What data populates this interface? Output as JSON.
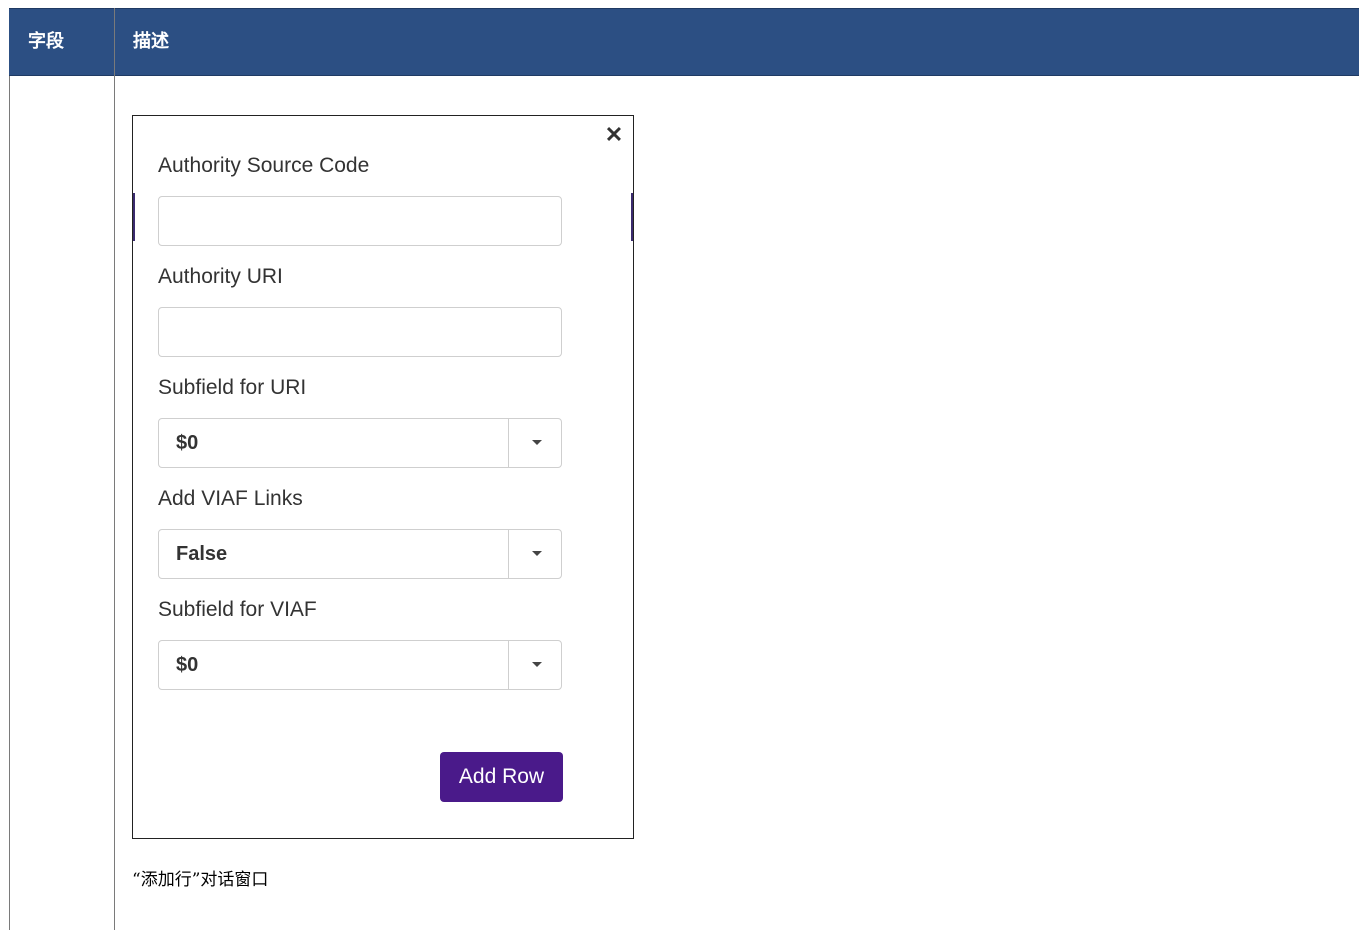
{
  "table": {
    "headers": [
      "字段",
      "描述"
    ]
  },
  "dialog": {
    "fields": [
      {
        "label": "Authority Source Code",
        "value": ""
      },
      {
        "label": "Authority URI",
        "value": ""
      },
      {
        "label": "Subfield for URI",
        "value": "$0"
      },
      {
        "label": "Add VIAF Links",
        "value": "False"
      },
      {
        "label": "Subfield for VIAF",
        "value": "$0"
      }
    ],
    "close_icon": "close-icon",
    "add_row_label": "Add Row"
  },
  "caption": "“添加行”对话窗口",
  "colors": {
    "header_bg": "#2c4f83",
    "button_bg": "#4a1a8a"
  }
}
